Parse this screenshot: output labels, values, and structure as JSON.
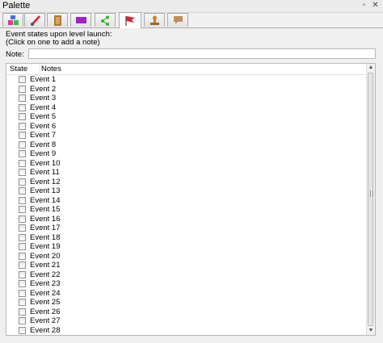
{
  "window": {
    "title": "Palette"
  },
  "tabs": [
    {
      "name": "tab-blocks",
      "icon": "blocks-icon"
    },
    {
      "name": "tab-brush",
      "icon": "brush-icon"
    },
    {
      "name": "tab-door",
      "icon": "door-icon"
    },
    {
      "name": "tab-platform",
      "icon": "purple-block-icon"
    },
    {
      "name": "tab-path",
      "icon": "path-icon"
    },
    {
      "name": "tab-events",
      "icon": "flag-icon",
      "active": true
    },
    {
      "name": "tab-stamp",
      "icon": "stamp-icon"
    },
    {
      "name": "tab-comments",
      "icon": "speech-bubble-icon"
    }
  ],
  "instructions": {
    "line1": "Event states upon level launch:",
    "line2": "(Click on one to add a note)"
  },
  "note": {
    "label": "Note:",
    "value": ""
  },
  "table": {
    "col_state": "State",
    "col_notes": "Notes",
    "rows": [
      "Event 1",
      "Event 2",
      "Event 3",
      "Event 4",
      "Event 5",
      "Event 6",
      "Event 7",
      "Event 8",
      "Event 9",
      "Event 10",
      "Event 11",
      "Event 12",
      "Event 13",
      "Event 14",
      "Event 15",
      "Event 16",
      "Event 17",
      "Event 18",
      "Event 19",
      "Event 20",
      "Event 21",
      "Event 22",
      "Event 23",
      "Event 24",
      "Event 25",
      "Event 26",
      "Event 27",
      "Event 28"
    ]
  }
}
